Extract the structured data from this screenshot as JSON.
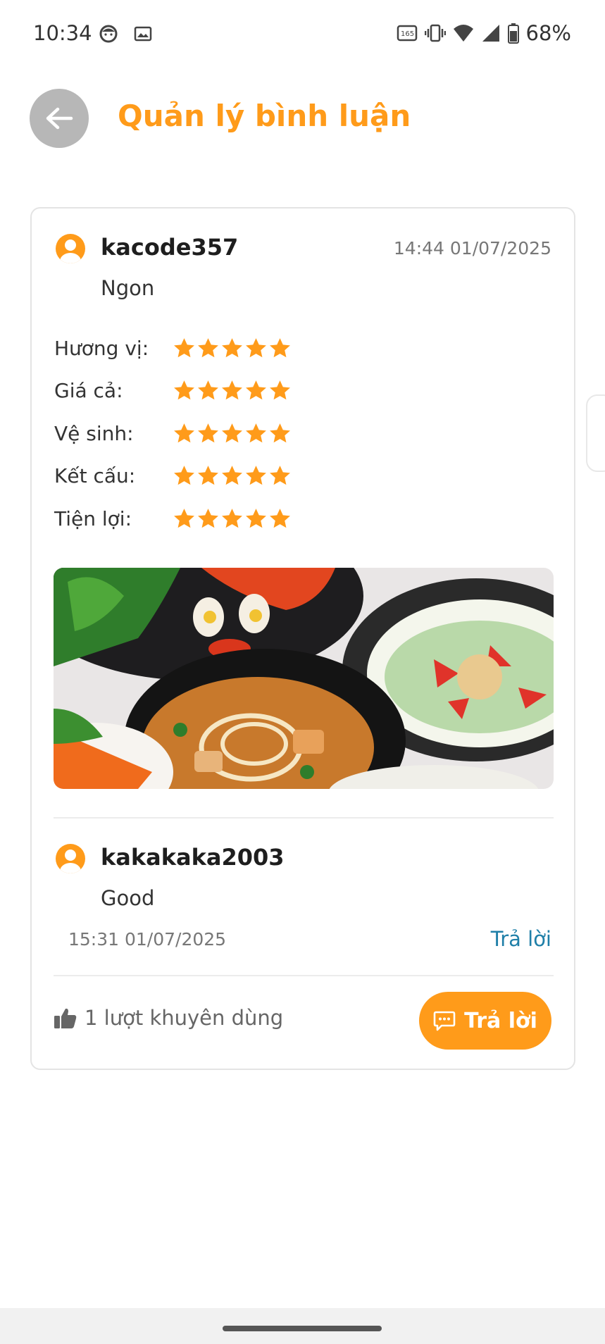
{
  "status_bar": {
    "time": "10:34",
    "battery": "68%",
    "icons": [
      "face-icon",
      "image-icon",
      "refresh-rate-icon",
      "vibrate-icon",
      "wifi-icon",
      "signal-icon",
      "battery-icon"
    ]
  },
  "header": {
    "title": "Quản lý bình luận",
    "back_icon": "arrow-left-icon"
  },
  "review": {
    "username": "kacode357",
    "date": "14:44 01/07/2025",
    "text": "Ngon",
    "ratings": [
      {
        "label": "Hương vị:",
        "stars": 5
      },
      {
        "label": "Giá cả:",
        "stars": 5
      },
      {
        "label": "Vệ sinh:",
        "stars": 5
      },
      {
        "label": "Kết cấu:",
        "stars": 5
      },
      {
        "label": "Tiện lợi:",
        "stars": 5
      }
    ],
    "image_alt_icon": "food-photo"
  },
  "reply": {
    "username": "kakakaka2003",
    "text": "Good",
    "date": "15:31 01/07/2025",
    "reply_link": "Trả lời"
  },
  "footer": {
    "recommend_text": "1 lượt khuyên dùng",
    "reply_button": "Trả lời"
  },
  "colors": {
    "accent": "#ff9b1a",
    "link": "#1f7fa8",
    "back_button": "#b7b7b7"
  }
}
